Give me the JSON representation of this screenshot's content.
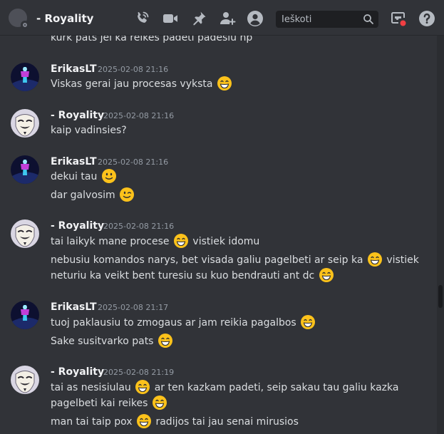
{
  "header": {
    "title": "- Royality",
    "search_placeholder": "Ieškoti",
    "icons": [
      "call-icon",
      "video-icon",
      "pin-icon",
      "add-friend-icon",
      "profile-icon",
      "search-icon",
      "inbox-icon",
      "help-icon"
    ],
    "accent_colors": {
      "icon": "#b5bac1",
      "notification_dot": "#f23f43"
    }
  },
  "messages": {
    "partial": {
      "line1": "kurk pats jei ka reikes padeti padesiu np"
    },
    "m1": {
      "author": "ErikasLT",
      "time": "2025-02-08 21:16",
      "line1": "Viskas gerai jau procesas vyksta"
    },
    "m2": {
      "author": "- Royality",
      "time": "2025-02-08 21:16",
      "line1": "kaip  vadinsies?"
    },
    "m3": {
      "author": "ErikasLT",
      "time": "2025-02-08 21:16",
      "line1": "dekui tau",
      "line2": "dar galvosim"
    },
    "m4": {
      "author": "- Royality",
      "time": "2025-02-08 21:16",
      "line1": "tai laikyk mane procese",
      "line1b": "vistiek idomu",
      "line2": "nebusiu komandos narys, bet visada galiu pagelbeti ar seip ka",
      "line2b": "vistiek",
      "line3": "neturiu ka veikt bent turesiu su kuo bendrauti ant dc"
    },
    "m5": {
      "author": "ErikasLT",
      "time": "2025-02-08 21:17",
      "line1": "tuoj paklausiu to zmogaus ar jam reikia pagalbos",
      "line2": "Sake susitvarko pats"
    },
    "m6": {
      "author": "- Royality",
      "time": "2025-02-08 21:19",
      "line1": "tai as nesisiulau",
      "line1b": "ar ten kazkam padeti, seip sakau tau galiu kazka",
      "line2": "pagelbeti kai reikes",
      "line3": "man tai taip pox",
      "line3b": "radijos tai jau senai mirusios"
    }
  },
  "emojis": {
    "grin": "grinning-smile-emoji",
    "slight": "slightly-smiling-emoji",
    "wink": "winking-emoji"
  }
}
